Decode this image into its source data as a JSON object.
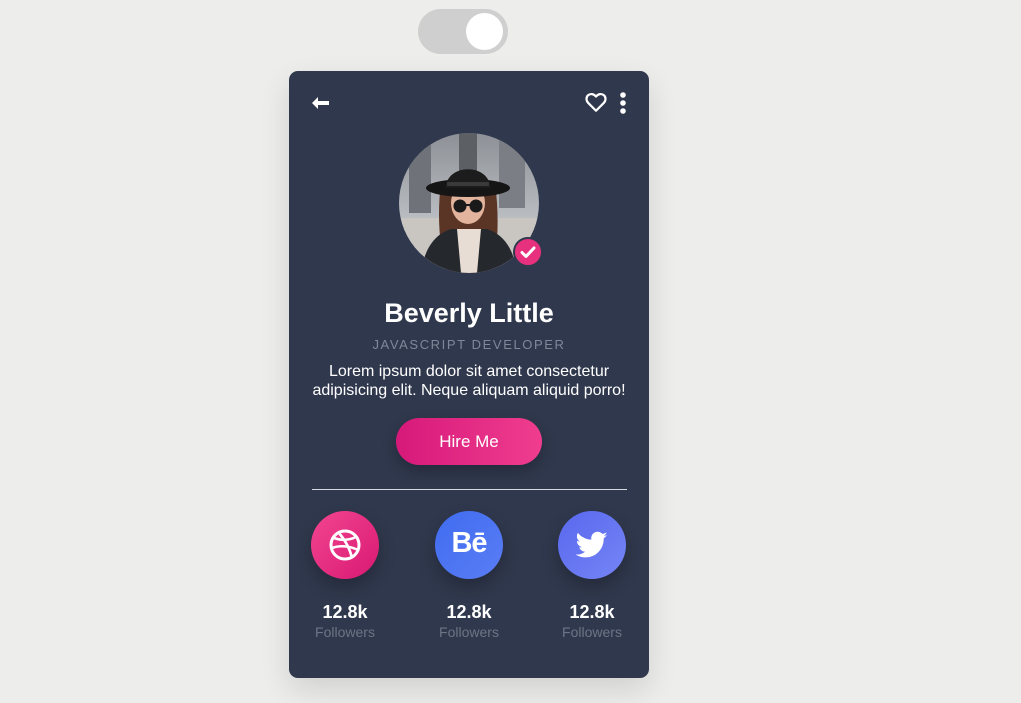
{
  "profile": {
    "name": "Beverly Little",
    "role": "JAVASCRIPT DEVELOPER",
    "bio": "Lorem ipsum dolor sit amet consectetur adipisicing elit. Neque aliquam aliquid porro!",
    "hire_label": "Hire Me"
  },
  "toggle": {
    "state": "on"
  },
  "social": [
    {
      "network": "dribbble",
      "icon": "dribbble-icon",
      "count": "12.8k",
      "label": "Followers"
    },
    {
      "network": "behance",
      "icon": "behance-icon",
      "glyph": "Bē",
      "count": "12.8k",
      "label": "Followers"
    },
    {
      "network": "twitter",
      "icon": "twitter-icon",
      "count": "12.8k",
      "label": "Followers"
    }
  ],
  "colors": {
    "background": "#ededeb",
    "card": "#30384d",
    "accent": "#e8317e",
    "behance": "#4a72f2",
    "twitter": "#6574f0"
  }
}
